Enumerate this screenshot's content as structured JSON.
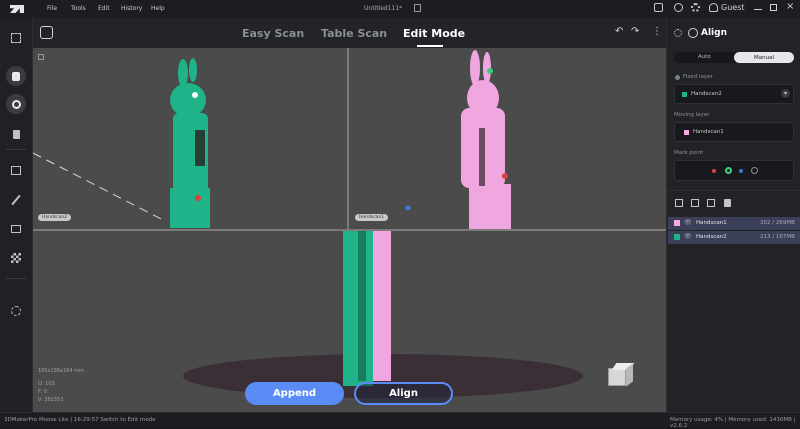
{
  "menu": [
    "File",
    "Tools",
    "Edit",
    "History",
    "Help"
  ],
  "window_title": "Untitled111*",
  "user": "Guest",
  "modes": [
    "Easy Scan",
    "Table Scan",
    "Edit Mode"
  ],
  "active_mode": "Edit Mode",
  "viewports": {
    "front_tag": "Handscan2",
    "side_tag": "Handscan1",
    "dimensions": "185x136x164 mm",
    "stats": [
      "O: 103",
      "F: 0",
      "V: 381553"
    ]
  },
  "buttons": {
    "append": "Append",
    "align": "Align"
  },
  "panel": {
    "title": "Align",
    "tabs": [
      "Auto",
      "Manual"
    ],
    "active_tab": "Manual",
    "fixed_label": "Fixed layer",
    "fixed_value": "Handscan2",
    "moving_label": "Moving layer",
    "moving_value": "Handscan1",
    "mark_label": "Mark point"
  },
  "layers": [
    {
      "name": "Handscan1",
      "size": "302 / 269MB",
      "color": "#f6a9e2"
    },
    {
      "name": "Handscan2",
      "size": "213 / 167MB",
      "color": "#1fb38a"
    }
  ],
  "status": {
    "left": "3DMakerPro Moose Lite  |  16:29:57 Switch to Edit mode",
    "right": "Memory usage: 4%  |  Memory used: 1430MB  |  v2.6.2"
  },
  "colors": {
    "accent": "#5b8cf5",
    "green_scan": "#1fb38a",
    "pink_scan": "#f0a6df",
    "viewport_bg": "#4b4b4b"
  }
}
